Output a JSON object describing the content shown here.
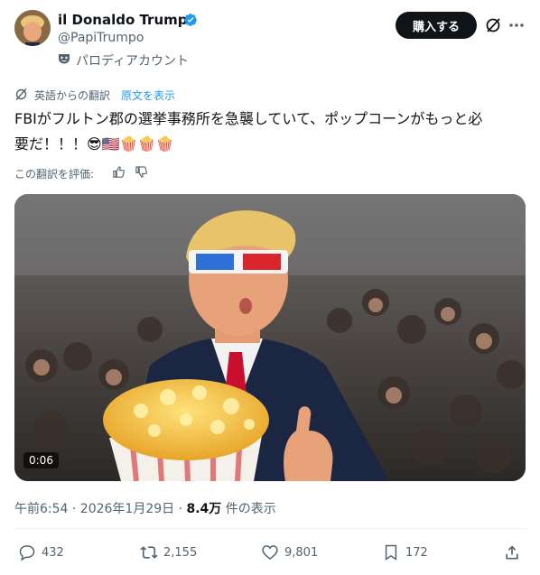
{
  "user": {
    "name": "il Donaldo Trumpo",
    "handle": "@PapiTrumpo",
    "parody_label": "パロディアカウント"
  },
  "header": {
    "subscribe_label": "購入する"
  },
  "translation": {
    "from_label": "英語からの翻訳",
    "show_original": "原文を表示"
  },
  "tweet": {
    "text": "FBIがフルトン郡の選挙事務所を急襲していて、ポップコーンがもっと必",
    "text_line2": "要だ！！！😎🇺🇸🍿🍿🍿",
    "rate_label": "この翻訳を評価:"
  },
  "media": {
    "duration": "0:06"
  },
  "meta": {
    "time": "午前6:54 · 2026年1月29日 · ",
    "views": "8.4万",
    "views_suffix": " 件の表示"
  },
  "actions": {
    "replies": "432",
    "reposts": "2,155",
    "likes": "9,801",
    "bookmarks": "172"
  },
  "colors": {
    "accent": "#1d9bf0",
    "text": "#0f1419",
    "muted": "#536471"
  }
}
